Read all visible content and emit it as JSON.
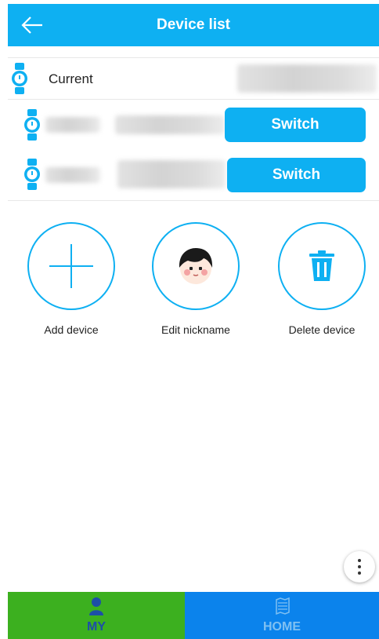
{
  "header": {
    "title": "Device list"
  },
  "current_row": {
    "label": "Current"
  },
  "devices": [
    {
      "switch_label": "Switch"
    },
    {
      "switch_label": "Switch"
    }
  ],
  "actions": {
    "add_label": "Add device",
    "edit_label": "Edit nickname",
    "delete_label": "Delete device"
  },
  "nav": {
    "my_label": "MY",
    "home_label": "HOME"
  },
  "icons": {
    "back": "arrow-left-icon",
    "watch": "smartwatch-icon",
    "add": "plus-icon",
    "avatar": "cartoon-avatar-icon",
    "delete": "trash-icon",
    "more": "more-vertical-icon",
    "user": "user-icon",
    "home": "home-map-icon"
  },
  "colors": {
    "accent": "#0eb0f2",
    "nav_my": "#3cb01f",
    "nav_home": "#0b83ec",
    "nav_my_text": "#1d4fa8",
    "nav_home_text": "#7fc0f2"
  }
}
